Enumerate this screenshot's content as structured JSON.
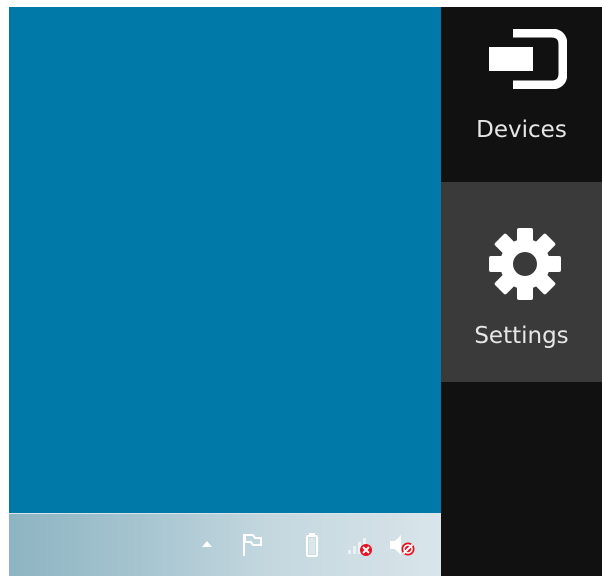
{
  "desktop": {
    "background_color": "#0079a8"
  },
  "taskbar": {
    "tray_icons": [
      "show-hidden-icons-arrow",
      "action-center-flag-icon",
      "battery-icon",
      "network-disconnected-icon",
      "volume-muted-icon"
    ]
  },
  "charms": {
    "devices": {
      "label": "Devices",
      "icon": "devices-icon"
    },
    "settings": {
      "label": "Settings",
      "icon": "gear-icon",
      "highlight_color": "#3a3a3a"
    }
  }
}
